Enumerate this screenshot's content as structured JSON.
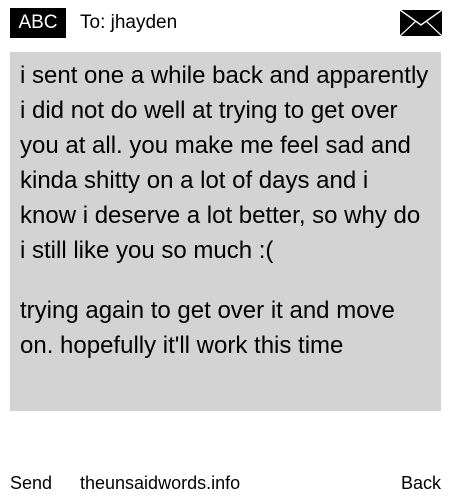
{
  "header": {
    "mode_label": "ABC",
    "to_line": "To: jhayden",
    "envelope_icon": "envelope-icon"
  },
  "message": {
    "text_1": "i sent one a while back and apparently i did not do well at trying to get over you at all. you make me feel sad and kinda shitty on a lot of days and i know i deserve a lot better, so why do i still like you so much :(",
    "text_2": "trying again to get over it and move on. hopefully it'll work this time"
  },
  "footer": {
    "send_label": "Send",
    "site_label": "theunsaidwords.info",
    "back_label": "Back"
  },
  "colors": {
    "background": "#ffffff",
    "message_box": "#d3d3d3",
    "badge_bg": "#000000",
    "badge_text": "#ffffff"
  }
}
